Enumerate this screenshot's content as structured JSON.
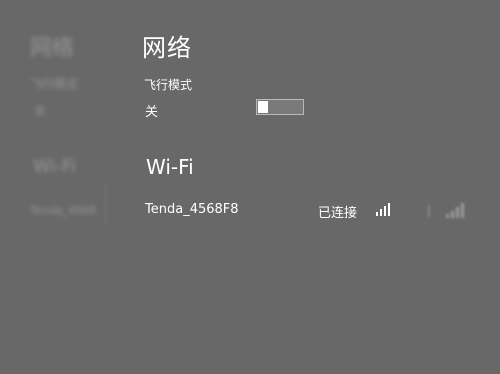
{
  "background_ghost": {
    "title": "网络",
    "airplane_label": "飞行模式",
    "airplane_state": "关",
    "wifi_heading": "Wi-Fi",
    "ssid": "Tenda_4568"
  },
  "panel": {
    "title": "网络",
    "airplane_mode": {
      "label": "飞行模式",
      "state_label": "关",
      "enabled": false
    },
    "wifi": {
      "heading": "Wi-Fi",
      "networks": [
        {
          "ssid": "Tenda_4568F8",
          "status": "已连接",
          "signal_icon": "wifi-signal-icon"
        }
      ]
    }
  },
  "colors": {
    "background": "#686868",
    "text": "#ffffff"
  }
}
